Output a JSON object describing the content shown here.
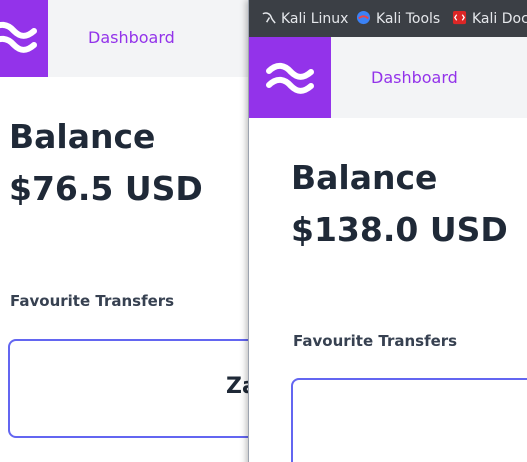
{
  "colors": {
    "brand": "#9333ea",
    "card_border": "#6366f1",
    "text_dark": "#1f2937",
    "bookmarks_bar": "#3b3f45"
  },
  "back_window": {
    "logo_icon": "wind-logo-icon",
    "nav": {
      "dashboard": "Dashboard"
    },
    "title": "Balance",
    "balance": "$76.5 USD",
    "section_title": "Favourite Transfers",
    "card_name_partial": "Za"
  },
  "front_window": {
    "bookmarks": [
      {
        "label": "Kali Linux",
        "icon": "kali-dragon-icon"
      },
      {
        "label": "Kali Tools",
        "icon": "kali-tools-icon"
      },
      {
        "label": "Kali Docs",
        "icon": "kali-docs-icon"
      }
    ],
    "logo_icon": "wind-logo-icon",
    "nav": {
      "dashboard": "Dashboard"
    },
    "title": "Balance",
    "balance": "$138.0 USD",
    "section_title": "Favourite Transfers"
  }
}
